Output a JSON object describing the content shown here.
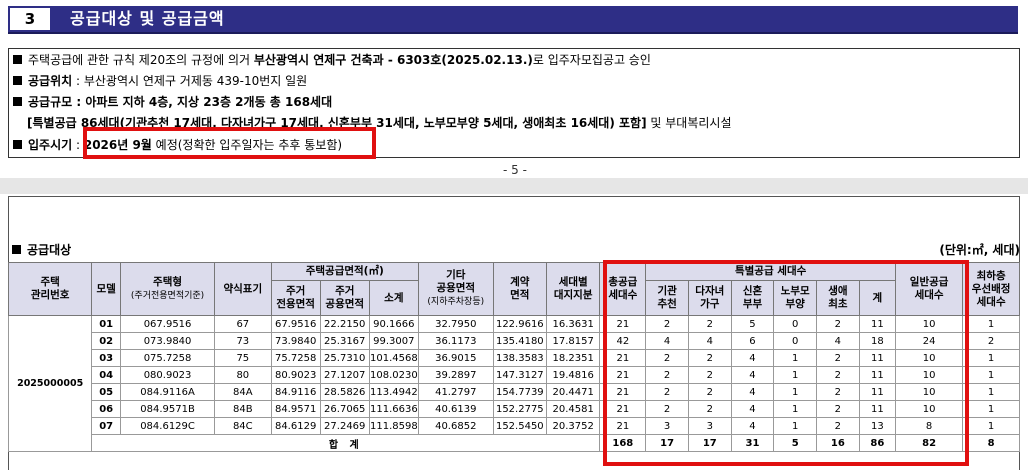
{
  "section": {
    "number": "3",
    "title": "공급대상 및 공급금액"
  },
  "info": {
    "approval": {
      "pre": "주택공급에 관한 규칙 제20조의 규정에 의거 ",
      "bold": "부산광역시 연제구 건축과 - 6303호(2025.02.13.)",
      "post": "로 입주자모집공고 승인"
    },
    "location": {
      "label": "공급위치",
      "value": " : 부산광역시 연제구 거제동 439-10번지 일원"
    },
    "scale": {
      "label": "공급규모",
      "value": " : 아파트 지하 4층, 지상 23층 2개동 총 168세대"
    },
    "special_bold": "[특별공급 86세대(기관추천 17세대, 다자녀가구 17세대, 신혼부부 31세대, 노부모부양 5세대, 생애최초 16세대) 포함]",
    "special_post": " 및 부대복리시설",
    "move_in": {
      "label": "입주시기",
      "sep": " : ",
      "bold": "2026년 9월",
      "post": " 예정(정확한 입주일자는 추후 통보함)"
    }
  },
  "page_number": "- 5 -",
  "supply": {
    "title": "공급대상",
    "unit": "(단위:㎡, 세대)"
  },
  "table": {
    "headers": {
      "mgmt": [
        "주택",
        "관리번호"
      ],
      "model": "모델",
      "type": [
        "주택형",
        "(주거전용면적기준)"
      ],
      "short": "약식표기",
      "area_group": "주택공급면적(㎡)",
      "exclusive": [
        "주거",
        "전용면적"
      ],
      "common": [
        "주거",
        "공용면적"
      ],
      "subtotal": "소계",
      "other": [
        "기타",
        "공용면적",
        "(지하주차장등)"
      ],
      "contract": [
        "계약",
        "면적"
      ],
      "land": [
        "세대별",
        "대지지분"
      ],
      "total": [
        "총공급",
        "세대수"
      ],
      "special_group": "특별공급 세대수",
      "inst": [
        "기관",
        "추천"
      ],
      "multi": [
        "다자녀",
        "가구"
      ],
      "newly": [
        "신혼",
        "부부"
      ],
      "elder": [
        "노부모",
        "부양"
      ],
      "first": [
        "생애",
        "최초"
      ],
      "sum": "계",
      "general": [
        "일반공급",
        "세대수"
      ],
      "top": [
        "최하층",
        "우선배정",
        "세대수"
      ]
    },
    "mgmt_no": "2025000005",
    "rows": [
      [
        "01",
        "067.9516",
        "67",
        "67.9516",
        "22.2150",
        "90.1666",
        "32.7950",
        "122.9616",
        "16.3631",
        "21",
        "2",
        "2",
        "5",
        "0",
        "2",
        "11",
        "10",
        "1"
      ],
      [
        "02",
        "073.9840",
        "73",
        "73.9840",
        "25.3167",
        "99.3007",
        "36.1173",
        "135.4180",
        "17.8157",
        "42",
        "4",
        "4",
        "6",
        "0",
        "4",
        "18",
        "24",
        "2"
      ],
      [
        "03",
        "075.7258",
        "75",
        "75.7258",
        "25.7310",
        "101.4568",
        "36.9015",
        "138.3583",
        "18.2351",
        "21",
        "2",
        "2",
        "4",
        "1",
        "2",
        "11",
        "10",
        "1"
      ],
      [
        "04",
        "080.9023",
        "80",
        "80.9023",
        "27.1207",
        "108.0230",
        "39.2897",
        "147.3127",
        "19.4816",
        "21",
        "2",
        "2",
        "4",
        "1",
        "2",
        "11",
        "10",
        "1"
      ],
      [
        "05",
        "084.9116A",
        "84A",
        "84.9116",
        "28.5826",
        "113.4942",
        "41.2797",
        "154.7739",
        "20.4471",
        "21",
        "2",
        "2",
        "4",
        "1",
        "2",
        "11",
        "10",
        "1"
      ],
      [
        "06",
        "084.9571B",
        "84B",
        "84.9571",
        "26.7065",
        "111.6636",
        "40.6139",
        "152.2775",
        "20.4581",
        "21",
        "2",
        "2",
        "4",
        "1",
        "2",
        "11",
        "10",
        "1"
      ],
      [
        "07",
        "084.6129C",
        "84C",
        "84.6129",
        "27.2469",
        "111.8598",
        "40.6852",
        "152.5450",
        "20.3752",
        "21",
        "3",
        "3",
        "4",
        "1",
        "2",
        "13",
        "8",
        "1"
      ]
    ],
    "total_label": "합 계",
    "totals": [
      "168",
      "17",
      "17",
      "31",
      "5",
      "16",
      "86",
      "82",
      "8"
    ]
  }
}
